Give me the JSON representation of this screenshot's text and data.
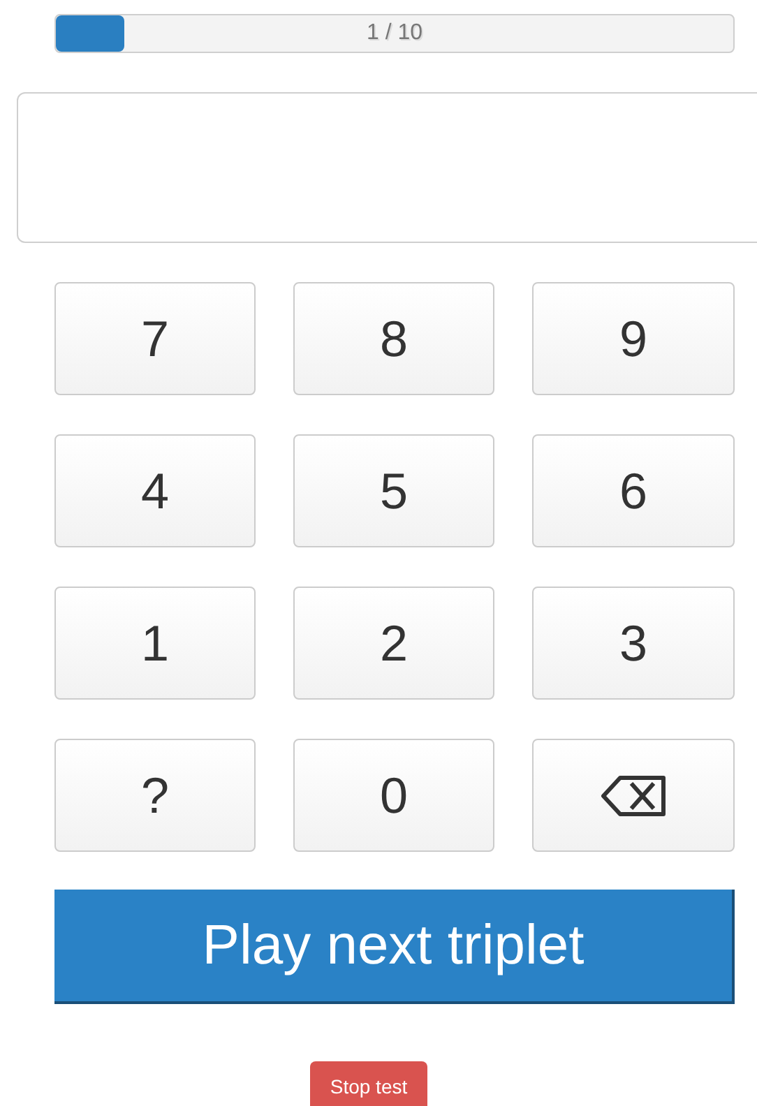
{
  "progress": {
    "label": "1 / 10",
    "level": 0.1
  },
  "keypad": [
    {
      "kind": "key",
      "label": "7"
    },
    {
      "kind": "key",
      "label": "8"
    },
    {
      "kind": "key",
      "label": "9"
    },
    {
      "kind": "key",
      "label": "4"
    },
    {
      "kind": "key",
      "label": "5"
    },
    {
      "kind": "key",
      "label": "6"
    },
    {
      "kind": "key",
      "label": "1"
    },
    {
      "kind": "key",
      "label": "2"
    },
    {
      "kind": "key",
      "label": "3"
    },
    {
      "kind": "key",
      "label": "?"
    },
    {
      "kind": "key",
      "label": "0"
    },
    {
      "kind": "backspace"
    }
  ],
  "play_button": "Play next triplet",
  "stop_button": "Stop test"
}
